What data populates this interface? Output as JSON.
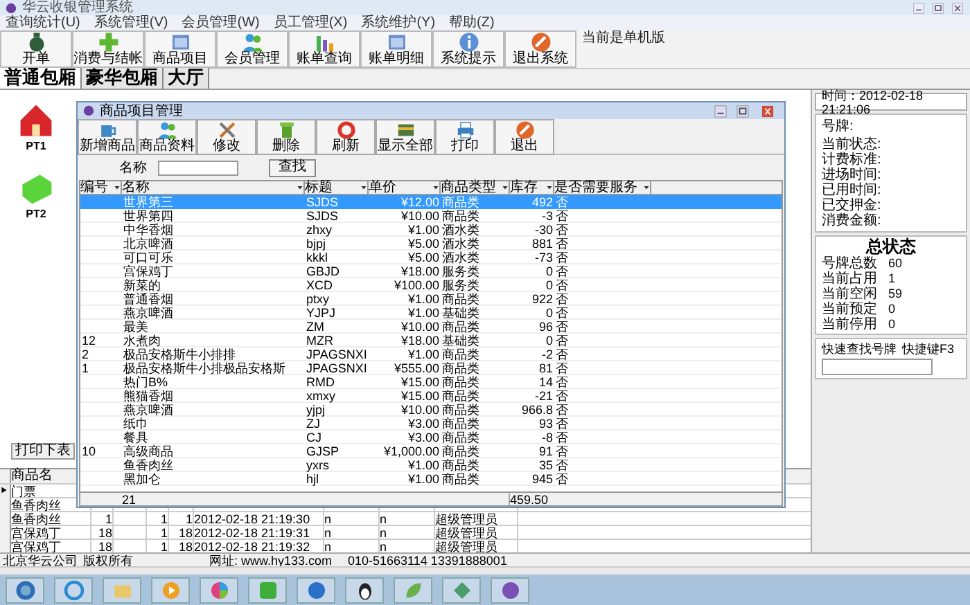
{
  "window": {
    "title": "华云收银管理系统"
  },
  "menu": [
    "查询统计(U)",
    "系统管理(V)",
    "会员管理(W)",
    "员工管理(X)",
    "系统维护(Y)",
    "帮助(Z)"
  ],
  "toolbar": [
    "开单",
    "消费与结帐",
    "商品项目",
    "会员管理",
    "账单查询",
    "账单明细",
    "系统提示",
    "退出系统"
  ],
  "edition_note": "当前是单机版",
  "room_tabs": [
    {
      "label": "普通包厢",
      "selected": true
    },
    {
      "label": "豪华包厢",
      "selected": false
    },
    {
      "label": "大厅",
      "selected": false
    }
  ],
  "rooms": [
    {
      "label": "PT1",
      "occupied": true
    },
    {
      "label": "PT2",
      "occupied": false
    }
  ],
  "print_button": "打印下表",
  "order_table": {
    "columns": [
      "商品名"
    ],
    "rows": [
      {
        "name": "门票",
        "selected": true
      },
      {
        "name": "鱼香肉丝",
        "selected": false
      },
      {
        "name": "鱼香肉丝",
        "column_2": "1",
        "column_4": "1",
        "column_5": "1",
        "column_6": "2012-02-18 21:19:30",
        "column_7": "n",
        "column_8": "n",
        "column_9": "超级管理员",
        "selected": false
      },
      {
        "name": "宫保鸡丁",
        "column_2": "18",
        "column_4": "1",
        "column_5": "18",
        "column_6": "2012-02-18 21:19:31",
        "column_7": "n",
        "column_8": "n",
        "column_9": "超级管理员",
        "selected": false
      },
      {
        "name": "宫保鸡丁",
        "column_2": "18",
        "column_4": "1",
        "column_5": "18",
        "column_6": "2012-02-18 21:19:32",
        "column_7": "n",
        "column_8": "n",
        "column_9": "超级管理员",
        "selected": false
      }
    ]
  },
  "side_panel": {
    "time": "时间：2012-02-18 21:21:06",
    "plate_label": "号牌:",
    "details": [
      "当前状态:",
      "计费标准:",
      "进场时间:",
      "已用时间:",
      "已交押金:",
      "消费金额:"
    ],
    "summary_title": "总状态",
    "summary": [
      {
        "label": "号牌总数",
        "value": "60"
      },
      {
        "label": "当前占用",
        "value": "1"
      },
      {
        "label": "当前空闲",
        "value": "59"
      },
      {
        "label": "当前预定",
        "value": "0"
      },
      {
        "label": "当前停用",
        "value": "0"
      }
    ],
    "quick_search": {
      "label": "快速查找号牌",
      "hotkey": "快捷键F3"
    }
  },
  "dialog": {
    "title": "商品项目管理",
    "toolbar": [
      "新增商品",
      "商品资料",
      "修改",
      "删除",
      "刷新",
      "显示全部",
      "打印",
      "退出"
    ],
    "search": {
      "label": "名称",
      "button": "查找"
    },
    "columns": [
      "编号",
      "名称",
      "标题",
      "单价",
      "商品类型",
      "库存",
      "是否需要服务"
    ],
    "rows": [
      {
        "name": "世界第三",
        "code": "SJDS",
        "price": "¥12.00",
        "type": "商品类",
        "stock": "492",
        "service": "否",
        "selected": true
      },
      {
        "name": "世界第四",
        "code": "SJDS",
        "price": "¥10.00",
        "type": "商品类",
        "stock": "-3",
        "service": "否",
        "selected": false
      },
      {
        "name": "中华香烟",
        "code": "zhxy",
        "price": "¥1.00",
        "type": "酒水类",
        "stock": "-30",
        "service": "否",
        "selected": false
      },
      {
        "name": "北京啤酒",
        "code": "bjpj",
        "price": "¥5.00",
        "type": "酒水类",
        "stock": "881",
        "service": "否",
        "selected": false
      },
      {
        "name": "可口可乐",
        "code": "kkkl",
        "price": "¥5.00",
        "type": "酒水类",
        "stock": "-73",
        "service": "否",
        "selected": false
      },
      {
        "name": "宫保鸡丁",
        "code": "GBJD",
        "price": "¥18.00",
        "type": "服务类",
        "stock": "0",
        "service": "否",
        "selected": false
      },
      {
        "name": "新菜的",
        "code": "XCD",
        "price": "¥100.00",
        "type": "服务类",
        "stock": "0",
        "service": "否",
        "selected": false
      },
      {
        "name": "普通香烟",
        "code": "ptxy",
        "price": "¥1.00",
        "type": "商品类",
        "stock": "922",
        "service": "否",
        "selected": false
      },
      {
        "name": "燕京啤酒",
        "code": "YJPJ",
        "price": "¥1.00",
        "type": "基础类",
        "stock": "0",
        "service": "否",
        "selected": false
      },
      {
        "name": "最美",
        "code": "ZM",
        "price": "¥10.00",
        "type": "商品类",
        "stock": "96",
        "service": "否",
        "selected": false
      },
      {
        "no": "12",
        "name": "水煮肉",
        "code": "MZR",
        "price": "¥18.00",
        "type": "基础类",
        "stock": "0",
        "service": "否",
        "selected": false
      },
      {
        "no": "2",
        "name": "极品安格斯牛小排排",
        "code": "JPAGSNXI",
        "price": "¥1.00",
        "type": "商品类",
        "stock": "-2",
        "service": "否",
        "selected": false
      },
      {
        "no": "1",
        "name": "极品安格斯牛小排极品安格斯",
        "code": "JPAGSNXI",
        "price": "¥555.00",
        "type": "商品类",
        "stock": "81",
        "service": "否",
        "selected": false
      },
      {
        "name": "热门B%",
        "code": "RMD",
        "price": "¥15.00",
        "type": "商品类",
        "stock": "14",
        "service": "否",
        "selected": false
      },
      {
        "name": "熊猫香烟",
        "code": "xmxy",
        "price": "¥15.00",
        "type": "商品类",
        "stock": "-21",
        "service": "否",
        "selected": false
      },
      {
        "name": "燕京啤酒",
        "code": "yjpj",
        "price": "¥10.00",
        "type": "商品类",
        "stock": "966.8",
        "service": "否",
        "selected": false
      },
      {
        "name": "纸巾",
        "code": "ZJ",
        "price": "¥3.00",
        "type": "商品类",
        "stock": "93",
        "service": "否",
        "selected": false
      },
      {
        "name": "餐具",
        "code": "CJ",
        "price": "¥3.00",
        "type": "商品类",
        "stock": "-8",
        "service": "否",
        "selected": false
      },
      {
        "no": "10",
        "name": "高级商品",
        "code": "GJSP",
        "price": "¥1,000.00",
        "type": "商品类",
        "stock": "91",
        "service": "否",
        "selected": false
      },
      {
        "name": "鱼香肉丝",
        "code": "yxrs",
        "price": "¥1.00",
        "type": "商品类",
        "stock": "35",
        "service": "否",
        "selected": false
      },
      {
        "name": "黑加仑",
        "code": "hjl",
        "price": "¥1.00",
        "type": "商品类",
        "stock": "945",
        "service": "否",
        "selected": false
      }
    ],
    "footer": {
      "count": "21",
      "total": "459.50"
    }
  },
  "status_bar": [
    "北京华云公司",
    "版权所有",
    "网址: www.hy133.com",
    "010-51663114 13391888001"
  ]
}
